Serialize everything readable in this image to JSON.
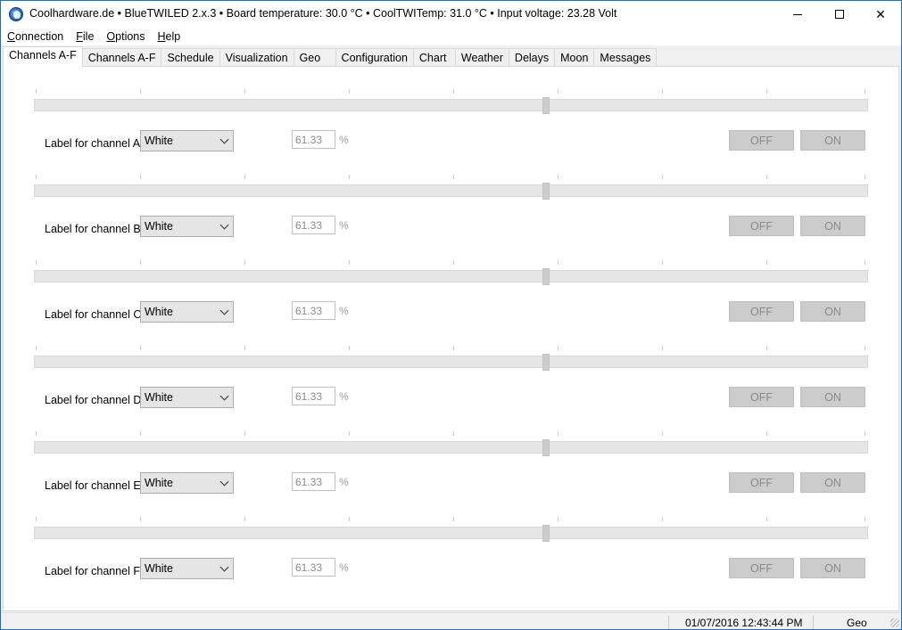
{
  "window": {
    "title": "Coolhardware.de • BlueTWILED 2.x.3 • Board temperature: 30.0 °C • CoolTWITemp: 31.0 °C • Input voltage: 23.28 Volt",
    "app_icon": "app-globe-icon",
    "controls": {
      "minimize": "minimize-icon",
      "maximize": "maximize-icon",
      "close": "✕"
    }
  },
  "menu": [
    {
      "mnemonic": "C",
      "rest": "onnection"
    },
    {
      "mnemonic": "F",
      "rest": "ile"
    },
    {
      "mnemonic": "O",
      "rest": "ptions"
    },
    {
      "mnemonic": "H",
      "rest": "elp"
    }
  ],
  "tabs": [
    {
      "label": "Channels A-F",
      "active": true
    },
    {
      "label": "Channels A-F",
      "active": false
    },
    {
      "label": "Schedule",
      "active": false
    },
    {
      "label": "Visualization",
      "active": false
    },
    {
      "label": "Geo",
      "active": false
    },
    {
      "label": "Configuration",
      "active": false
    },
    {
      "label": "Chart",
      "active": false
    },
    {
      "label": "Weather",
      "active": false
    },
    {
      "label": "Delays",
      "active": false
    },
    {
      "label": "Moon",
      "active": false
    },
    {
      "label": "Messages",
      "active": false
    }
  ],
  "channels": [
    {
      "label": "Label for channel A",
      "color": "White",
      "value": "61.33",
      "unit": "%",
      "off_label": "OFF",
      "on_label": "ON",
      "slider_fraction": 0.6133
    },
    {
      "label": "Label for channel B",
      "color": "White",
      "value": "61.33",
      "unit": "%",
      "off_label": "OFF",
      "on_label": "ON",
      "slider_fraction": 0.6133
    },
    {
      "label": "Label for channel C",
      "color": "White",
      "value": "61.33",
      "unit": "%",
      "off_label": "OFF",
      "on_label": "ON",
      "slider_fraction": 0.6133
    },
    {
      "label": "Label for channel D",
      "color": "White",
      "value": "61.33",
      "unit": "%",
      "off_label": "OFF",
      "on_label": "ON",
      "slider_fraction": 0.6133
    },
    {
      "label": "Label for channel E",
      "color": "White",
      "value": "61.33",
      "unit": "%",
      "off_label": "OFF",
      "on_label": "ON",
      "slider_fraction": 0.6133
    },
    {
      "label": "Label for channel F",
      "color": "White",
      "value": "61.33",
      "unit": "%",
      "off_label": "OFF",
      "on_label": "ON",
      "slider_fraction": 0.6133
    }
  ],
  "status": {
    "datetime": "01/07/2016 12:43:44 PM",
    "mode": "Geo"
  },
  "colors": {
    "window_border": "#1e6fc4",
    "disabled_button": "#cccccc",
    "disabled_text": "#8a8a8a"
  }
}
